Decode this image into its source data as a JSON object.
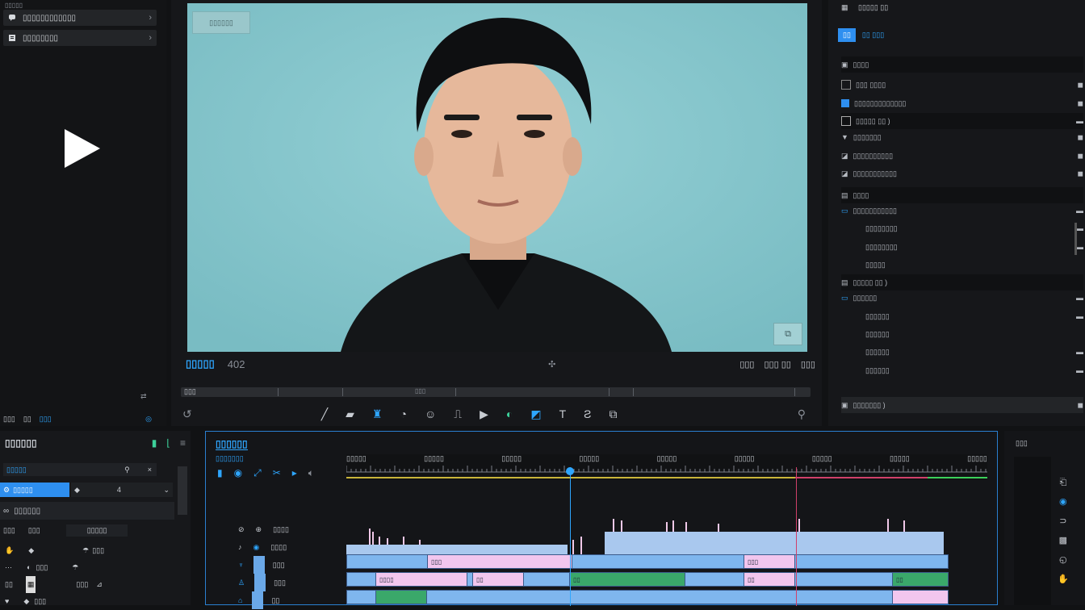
{
  "media": {
    "items": [
      {
        "label": "▯▯▯▯▯▯▯▯▯▯▯▯",
        "icon": "chat-icon"
      },
      {
        "label": "▯▯▯▯▯▯▯▯",
        "icon": "file-icon"
      }
    ],
    "top_label": "▯▯▯▯▯",
    "bottom_labels": [
      "▯▯▯",
      "▯▯",
      "▯▯▯"
    ]
  },
  "viewer": {
    "overlay_tag": "▯▯▯▯▯▯",
    "title": "▯▯▯▯▯",
    "counter": "402",
    "right_info": [
      "▯▯▯",
      "▯▯▯ ▯▯",
      "▯▯▯"
    ],
    "scrub_label": "▯▯▯",
    "scrub_mid": "▯▯▯"
  },
  "inspector": {
    "header": "▯▯▯▯▯ ▯▯",
    "tab_active": "▯▯",
    "tab_other": "▯▯ ▯▯▯",
    "sections": [
      {
        "title": "▯▯▯▯",
        "rows": [
          "▯▯▯ ▯▯▯▯",
          "▯▯▯▯▯▯▯▯▯▯▯▯▯",
          "▯▯▯▯▯ ▯▯ )",
          "▯▯▯▯▯▯▯",
          "▯▯▯▯▯▯▯▯▯▯",
          "▯▯▯▯▯▯▯▯▯▯▯"
        ]
      },
      {
        "title": "▯▯▯▯",
        "rows": [
          "▯▯▯▯▯▯▯▯▯▯▯",
          "▯▯▯▯▯▯▯▯",
          "▯▯▯▯▯▯▯▯",
          "▯▯▯▯▯"
        ]
      },
      {
        "title": "▯▯▯▯▯ ▯▯ )",
        "rows": [
          "▯▯▯▯▯▯",
          "▯▯▯▯▯▯",
          "▯▯▯▯▯▯",
          "▯▯▯▯▯▯",
          "▯▯▯▯▯▯"
        ]
      }
    ],
    "footer": "▯▯▯▯▯▯▯ )"
  },
  "fx": {
    "title": "▯▯▯▯▯▯",
    "search_placeholder": "▯▯▯▯▯",
    "selected": "▯▯▯▯▯",
    "list_title": "▯▯▯▯▯▯",
    "col_a": "▯▯▯",
    "col_b": "▯▯▯",
    "col_c": "▯▯▯▯▯",
    "items": [
      "▯▯▯",
      "▯▯▯",
      "▯▯▯",
      "▯▯▯"
    ]
  },
  "timeline": {
    "title": "▯▯▯▯▯▯",
    "subtitle": "▯▯▯▯▯▯▯",
    "ruler_labels": [
      "▯▯▯▯▯",
      "▯▯▯▯▯",
      "▯▯▯▯▯",
      "▯▯▯▯▯",
      "▯▯▯▯▯",
      "▯▯▯▯▯",
      "▯▯▯▯▯",
      "▯▯▯▯▯",
      "▯▯▯▯▯"
    ],
    "track_labels": [
      "▯▯▯▯",
      "▯▯▯▯",
      "▯▯▯",
      "▯▯▯",
      "▯▯"
    ]
  },
  "rightstrip": {
    "title": "▯▯▯"
  }
}
